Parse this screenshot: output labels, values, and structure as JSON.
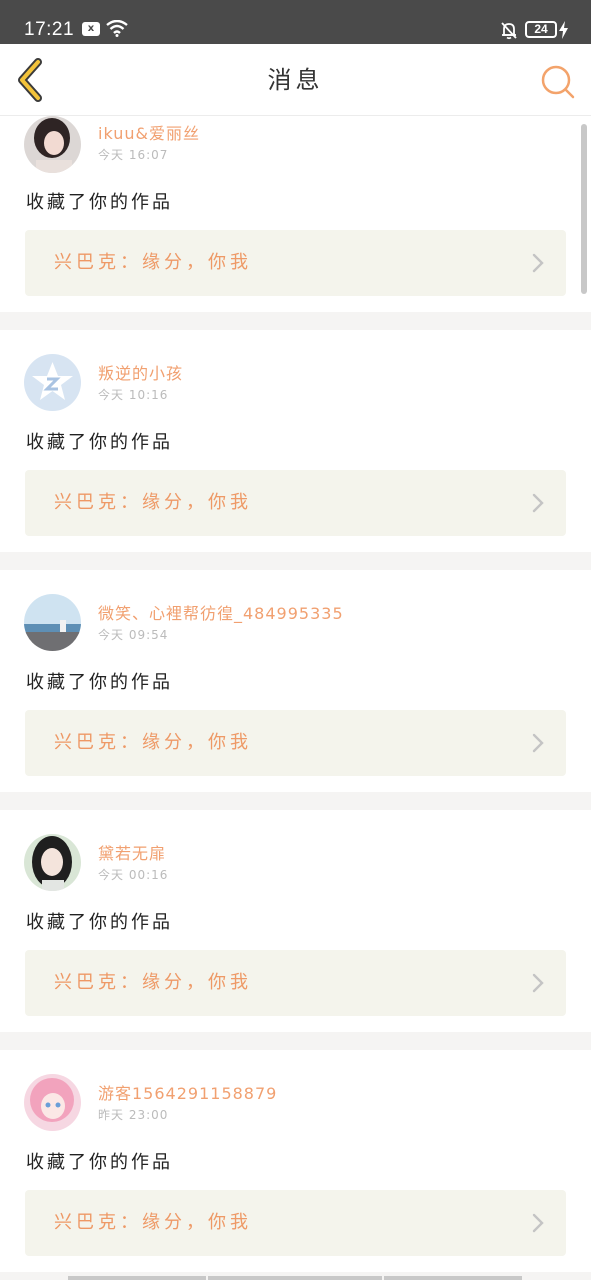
{
  "status_bar": {
    "time": "17:21",
    "battery": "24",
    "sim_label": "x"
  },
  "header": {
    "title": "消息"
  },
  "messages": [
    {
      "username": "ikuu&爱丽丝",
      "time": "今天 16:07",
      "action": "收藏了你的作品",
      "work_title": "兴巴克：缘分，你我"
    },
    {
      "username": "叛逆的小孩",
      "time": "今天 10:16",
      "action": "收藏了你的作品",
      "work_title": "兴巴克：缘分，你我"
    },
    {
      "username": "微笑、心裡帮彷徨_484995335",
      "time": "今天 09:54",
      "action": "收藏了你的作品",
      "work_title": "兴巴克：缘分，你我"
    },
    {
      "username": "黛若无扉",
      "time": "今天 00:16",
      "action": "收藏了你的作品",
      "work_title": "兴巴克：缘分，你我"
    },
    {
      "username": "游客1564291158879",
      "time": "昨天 23:00",
      "action": "收藏了你的作品",
      "work_title": "兴巴克：缘分，你我"
    }
  ],
  "colors": {
    "accent": "#ee9966",
    "back_arrow": "#f3c33a",
    "status_bar": "#4a4a4a",
    "card_work_bg": "#f4f4ec"
  },
  "icons": {
    "back": "chevron-left-icon",
    "search": "search-icon",
    "work_arrow": "chevron-right-icon"
  }
}
